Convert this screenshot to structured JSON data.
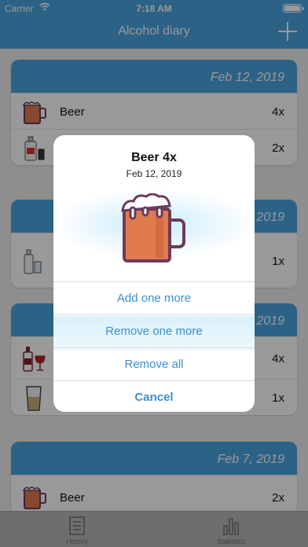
{
  "status": {
    "carrier": "Carrier",
    "time": "7:18 AM"
  },
  "nav": {
    "title": "Alcohol diary"
  },
  "days": [
    {
      "date": "Feb 12, 2019",
      "items": [
        {
          "name": "Beer",
          "qty": "4x",
          "icon": "beer-mug-icon"
        },
        {
          "name": "",
          "qty": "2x",
          "icon": "liquor-bottle-icon"
        }
      ]
    },
    {
      "date": "2019",
      "items": [
        {
          "name": "",
          "qty": "1x",
          "icon": "bottle-glass-icon"
        }
      ]
    },
    {
      "date": "2019",
      "items": [
        {
          "name": "",
          "qty": "4x",
          "icon": "wine-bottle-glass-icon"
        },
        {
          "name": "",
          "qty": "1x",
          "icon": "tall-glass-icon"
        }
      ]
    },
    {
      "date": "Feb 7, 2019",
      "items": [
        {
          "name": "Beer",
          "qty": "2x",
          "icon": "beer-mug-icon"
        }
      ]
    }
  ],
  "tabs": [
    {
      "label": "History",
      "icon": "history-list-icon"
    },
    {
      "label": "Statistics",
      "icon": "bar-chart-icon"
    }
  ],
  "modal": {
    "title": "Beer 4x",
    "date": "Feb 12, 2019",
    "icon": "beer-mug-icon",
    "actions": {
      "add": "Add one more",
      "remove_one": "Remove one more",
      "remove_all": "Remove all",
      "cancel": "Cancel"
    }
  },
  "colors": {
    "accent": "#4aa3e0",
    "action_text": "#3a8fd1",
    "beer": "#e07b4f",
    "mug_outline": "#6b3b5a"
  }
}
